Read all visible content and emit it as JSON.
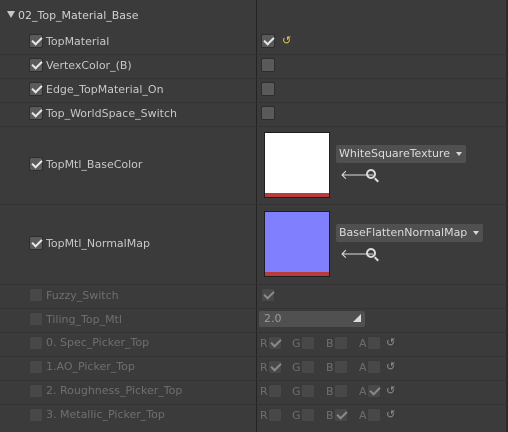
{
  "category": {
    "title": "02_Top_Material_Base"
  },
  "rows": {
    "top_material": {
      "label": "TopMaterial",
      "checked": true,
      "value_checked": true
    },
    "vertex_color": {
      "label": "VertexColor_(B)",
      "checked": true,
      "value_checked": false
    },
    "edge_top": {
      "label": "Edge_TopMaterial_On",
      "checked": true,
      "value_checked": false
    },
    "worldspace": {
      "label": "Top_WorldSpace_Switch",
      "checked": true,
      "value_checked": false
    },
    "base_color": {
      "label": "TopMtl_BaseColor",
      "checked": true,
      "texture": "WhiteSquareTexture",
      "swatch_color": "#ffffff"
    },
    "normal_map": {
      "label": "TopMtl_NormalMap",
      "checked": true,
      "texture": "BaseFlattenNormalMap",
      "swatch_color": "#8080ff"
    },
    "fuzzy": {
      "label": "Fuzzy_Switch",
      "checked": false,
      "value_checked": true
    },
    "tiling": {
      "label": "Tiling_Top_Mtl",
      "checked": false,
      "value": "2.0"
    },
    "spec": {
      "label": "0. Spec_Picker_Top",
      "channels": {
        "R": true,
        "G": false,
        "B": false,
        "A": false
      }
    },
    "ao": {
      "label": "1.AO_Picker_Top",
      "channels": {
        "R": true,
        "G": false,
        "B": false,
        "A": false
      }
    },
    "rough": {
      "label": "2. Roughness_Picker_Top",
      "channels": {
        "R": false,
        "G": false,
        "B": false,
        "A": true
      }
    },
    "metal": {
      "label": "3. Metallic_Picker_Top",
      "channels": {
        "R": false,
        "G": false,
        "B": true,
        "A": false
      }
    }
  },
  "channel_labels": {
    "r": "R",
    "g": "G",
    "b": "B",
    "a": "A"
  },
  "icons": {
    "reset": "reset-to-default-icon",
    "use": "use-selected-arrow-icon",
    "browse": "browse-magnifier-icon"
  },
  "colors": {
    "panel": "#3b3b3b",
    "reset_active": "#e6c84a",
    "texture_strip": "#b83c3c"
  }
}
